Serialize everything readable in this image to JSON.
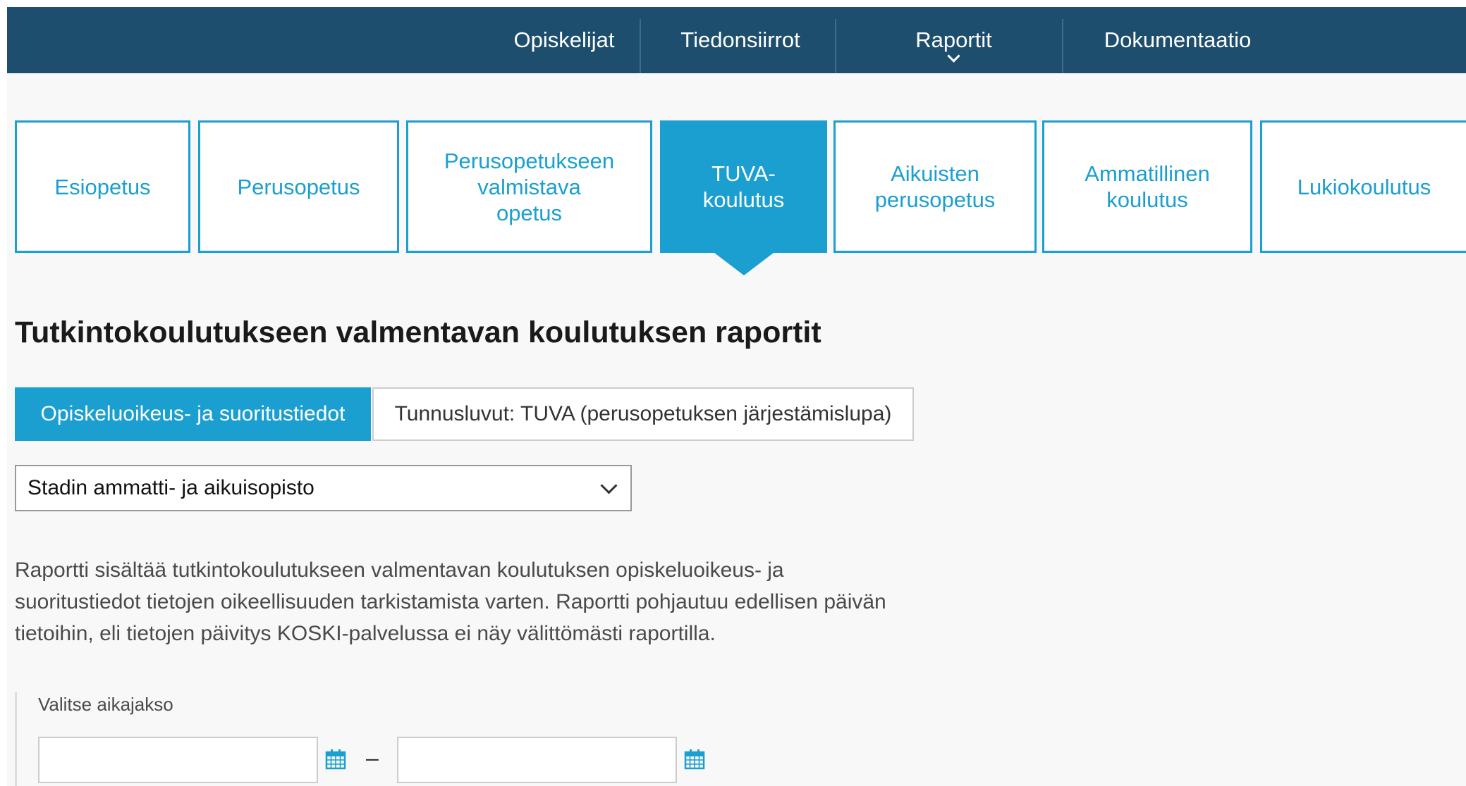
{
  "topnav": {
    "items": [
      "Opiskelijat",
      "Tiedonsiirrot",
      "Raportit",
      "Dokumentaatio"
    ]
  },
  "education_tabs": [
    "Esiopetus",
    "Perusopetus",
    "Perusopetukseen\nvalmistava\nopetus",
    "TUVA-\nkoulutus",
    "Aikuisten\nperusopetus",
    "Ammatillinen\nkoulutus",
    "Lukiokoulutus"
  ],
  "active_tab": "TUVA-koulutus",
  "page_title": "Tutkintokoulutukseen valmentavan koulutuksen raportit",
  "report_buttons": {
    "selected": "Opiskeluoikeus- ja suoritustiedot",
    "other": "Tunnusluvut: TUVA (perusopetuksen järjestämislupa)"
  },
  "organization_select": {
    "value": "Stadin ammatti- ja aikuisopisto"
  },
  "description": "Raportti sisältää tutkintokoulutukseen valmentavan koulutuksen opiskeluoikeus- ja suoritustiedot tietojen oikeellisuuden tarkistamista varten. Raportti pohjautuu edellisen päivän tietoihin, eli tietojen päivitys KOSKI-palvelussa ei näy välittömästi raportilla.",
  "date_range": {
    "label": "Valitse aikajakso",
    "separator": "–",
    "start_value": "",
    "end_value": ""
  },
  "colors": {
    "nav_bg": "#1e4e6d",
    "accent": "#1b9fd0"
  },
  "icons": [
    "chevron-down-icon",
    "calendar-icon"
  ]
}
